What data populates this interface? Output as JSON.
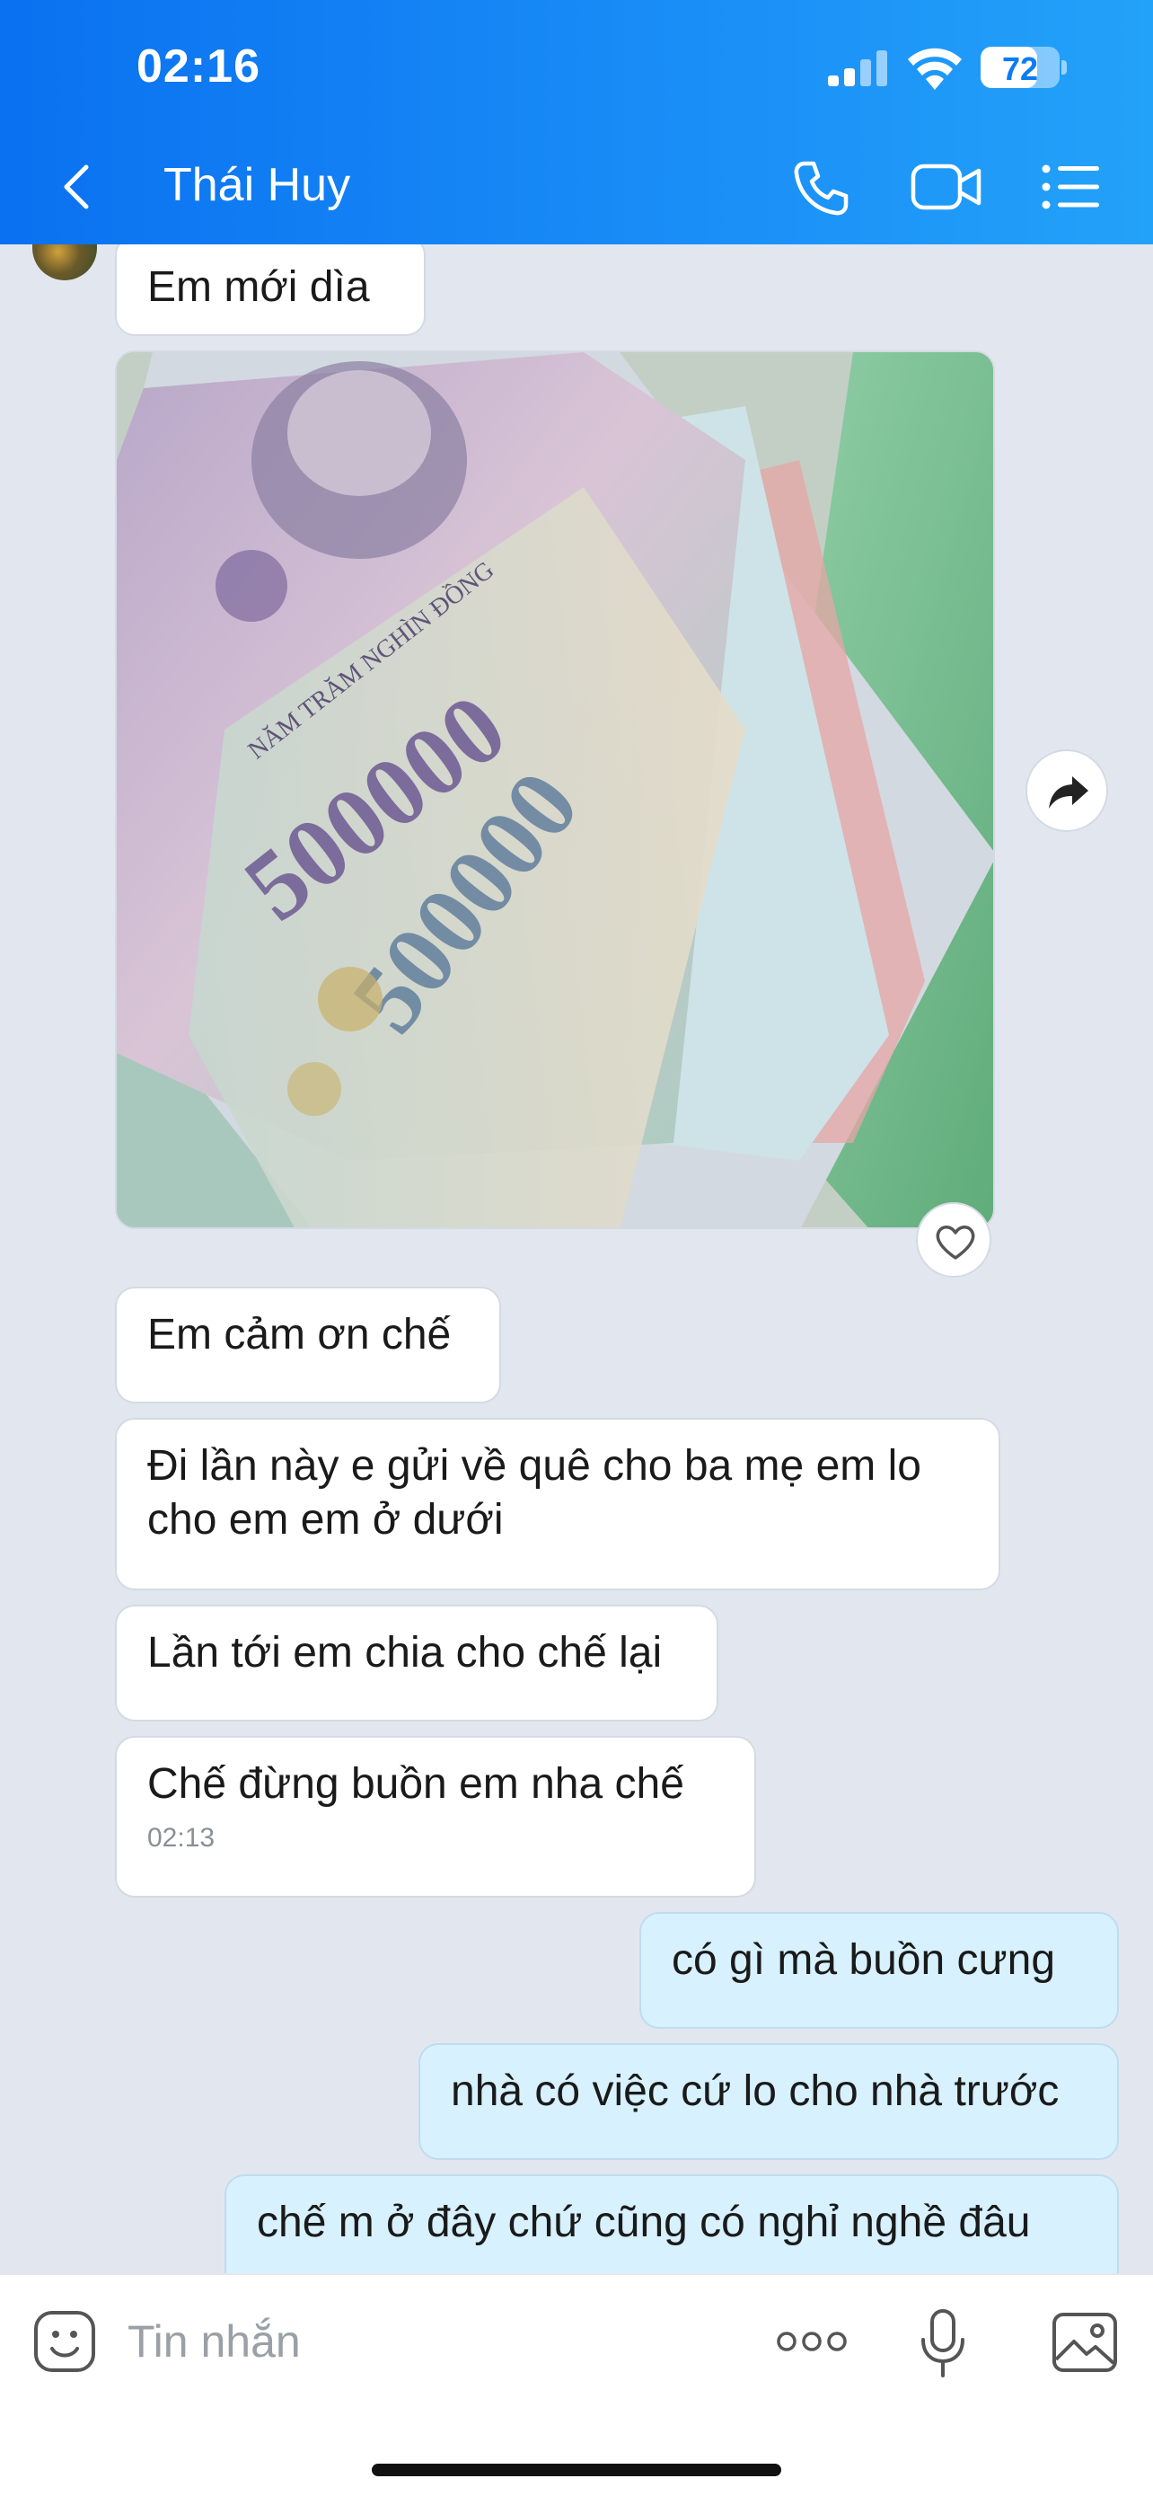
{
  "status_bar": {
    "time": "02:16",
    "battery": "72",
    "battery_level": 0.72
  },
  "header": {
    "contact_name": "Thái Huy"
  },
  "messages": {
    "m0": {
      "text": "Em mới dìa"
    },
    "m1": {
      "text": "Em cảm ơn chế"
    },
    "m2": {
      "text": "Đi lần này e gửi về quê cho ba mẹ em lo cho em em ở dưới"
    },
    "m3": {
      "text": "Lần tới em chia cho chế lại"
    },
    "m4": {
      "text": "Chế đừng buồn em nha chế",
      "time": "02:13"
    },
    "m5": {
      "text": "có gì mà buồn cưng"
    },
    "m6": {
      "text": "nhà có việc cứ lo cho nhà trước"
    },
    "m7": {
      "text": "chế m ở đây chứ cũng có nghỉ nghề đâu"
    }
  },
  "photo": {
    "banknote_values": [
      "500000",
      "500000"
    ],
    "banknote_text": "NĂM TRĂM NGHÌN ĐỒNG"
  },
  "input_bar": {
    "placeholder": "Tin nhắn"
  },
  "colors": {
    "header_start": "#0a71f0",
    "header_end": "#23a2f9",
    "outgoing_bubble": "#d7f1fe",
    "incoming_bubble": "#ffffff",
    "chat_bg": "#e2e7ef"
  },
  "icons": [
    "signal-icon",
    "wifi-icon",
    "battery-icon",
    "back-icon",
    "call-icon",
    "video-call-icon",
    "menu-icon",
    "heart-icon",
    "share-icon",
    "sticker-icon",
    "more-icon",
    "mic-icon",
    "gallery-icon"
  ]
}
